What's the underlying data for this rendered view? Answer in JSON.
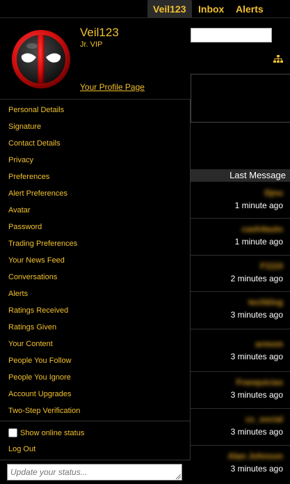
{
  "nav": {
    "user": "Veil123",
    "inbox": "Inbox",
    "alerts": "Alerts"
  },
  "profile": {
    "username": "Veil123",
    "title": "Jr. VIP",
    "profile_link": "Your Profile Page",
    "avatar_icon": "deadpool-avatar-icon"
  },
  "menu": {
    "items": [
      "Personal Details",
      "Signature",
      "Contact Details",
      "Privacy",
      "Preferences",
      "Alert Preferences",
      "Avatar",
      "Password",
      "Trading Preferences",
      "Your News Feed",
      "Conversations",
      "Alerts",
      "Ratings Received",
      "Ratings Given",
      "Your Content",
      "People You Follow",
      "People You Ignore",
      "Account Upgrades",
      "Two-Step Verification"
    ]
  },
  "footer": {
    "show_online": "Show online status",
    "logout": "Log Out",
    "status_placeholder": "Update your status..."
  },
  "background": {
    "header": "Last Message",
    "sitemap_icon": "sitemap-icon",
    "rows": [
      {
        "user": "Djnu",
        "time": "1 minute ago"
      },
      {
        "user": "cash4auto",
        "time": "1 minute ago"
      },
      {
        "user": "F1110",
        "time": "2 minutes ago"
      },
      {
        "user": "techblog",
        "time": "3 minutes ago"
      },
      {
        "user": "armom",
        "time": "3 minutes ago"
      },
      {
        "user": "Franquicias",
        "time": "3 minutes ago"
      },
      {
        "user": "cc_social",
        "time": "3 minutes ago"
      },
      {
        "user": "Alan Johnson",
        "time": "3 minutes ago"
      }
    ]
  },
  "colors": {
    "accent": "#f2c12e",
    "background": "#000000"
  }
}
